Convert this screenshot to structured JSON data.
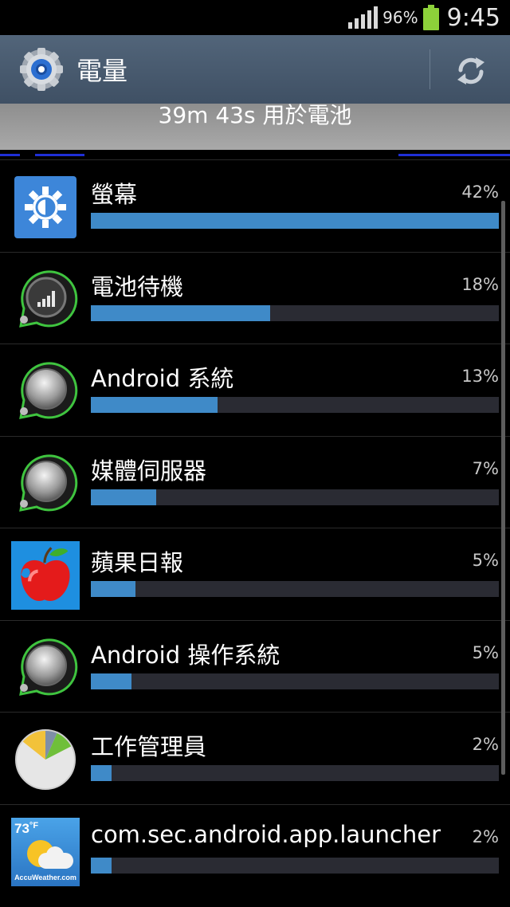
{
  "status_bar": {
    "battery_percent": "96%",
    "time": "9:45",
    "icons": [
      "signal-icon",
      "battery-icon"
    ],
    "battery_color": "#8dd13a"
  },
  "action_bar": {
    "title": "電量",
    "icons": [
      "gear-icon",
      "refresh-icon"
    ]
  },
  "summary": {
    "text": "39m 43s 用於電池"
  },
  "usage": [
    {
      "name": "螢幕",
      "percent_text": "42%",
      "fraction": 1.0,
      "icon": "screen-brightness-icon"
    },
    {
      "name": "電池待機",
      "percent_text": "18%",
      "fraction": 0.44,
      "icon": "cell-standby-icon"
    },
    {
      "name": "Android 系統",
      "percent_text": "13%",
      "fraction": 0.31,
      "icon": "android-system-icon"
    },
    {
      "name": "媒體伺服器",
      "percent_text": "7%",
      "fraction": 0.16,
      "icon": "media-server-icon"
    },
    {
      "name": "蘋果日報",
      "percent_text": "5%",
      "fraction": 0.11,
      "icon": "apple-daily-icon"
    },
    {
      "name": "Android 操作系統",
      "percent_text": "5%",
      "fraction": 0.1,
      "icon": "android-os-icon"
    },
    {
      "name": "工作管理員",
      "percent_text": "2%",
      "fraction": 0.05,
      "icon": "task-manager-icon"
    },
    {
      "name": "com.sec.android.app.launcher",
      "percent_text": "2%",
      "fraction": 0.05,
      "icon": "accuweather-icon"
    }
  ],
  "widget_text": {
    "temperature": "73",
    "unit": "°F",
    "brand": "AccuWeather.com"
  },
  "colors": {
    "bar_fill": "#3f8ac8",
    "bar_track": "#2a2b33",
    "action_bar": "#4a5c70"
  }
}
